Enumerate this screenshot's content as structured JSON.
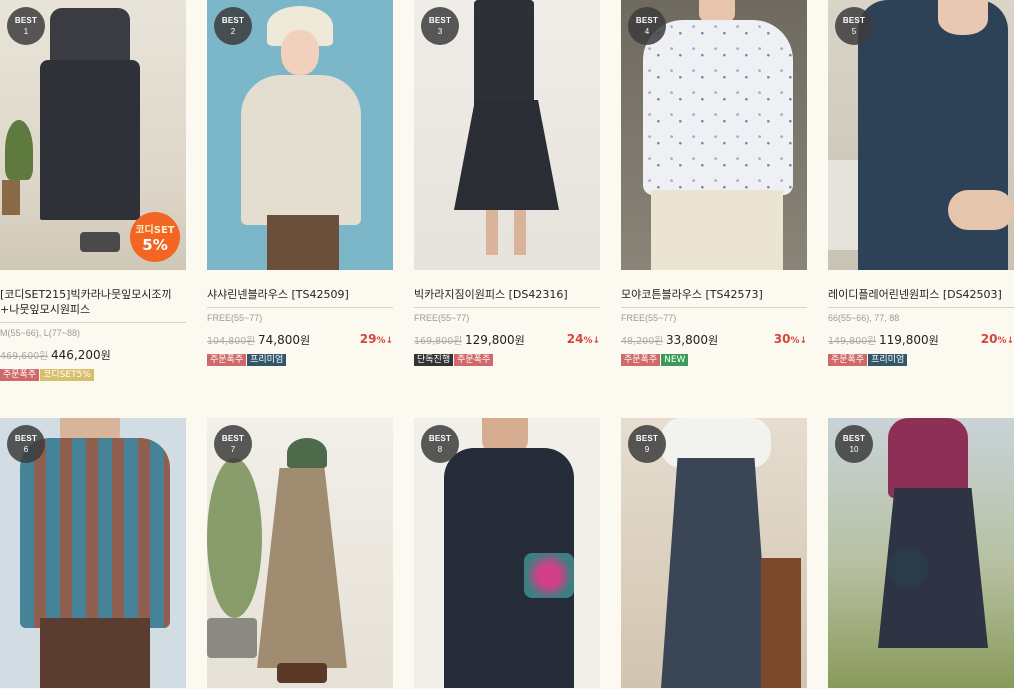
{
  "products_row1": [
    {
      "best_label": "BEST",
      "rank": "1",
      "title": "[코디SET215]빅카라나뭇잎모시조끼+나뭇잎모시원피스",
      "size": "M(55~66), L(77~88)",
      "old_price": "469,600원",
      "price": "446,200",
      "won": "원",
      "rate": "",
      "tags": [
        "주문폭주",
        "코디SET5%"
      ],
      "coupon": {
        "line1": "코디SET",
        "line2": "5%"
      }
    },
    {
      "best_label": "BEST",
      "rank": "2",
      "title": "샤샤린넨블라우스 [TS42509]",
      "size": "FREE(55~77)",
      "old_price": "104,800원",
      "price": "74,800",
      "won": "원",
      "rate": "29",
      "tags": [
        "주문폭주",
        "프리미엄"
      ]
    },
    {
      "best_label": "BEST",
      "rank": "3",
      "title": "빅카라지짐이원피스 [DS42316]",
      "size": "FREE(55~77)",
      "old_price": "169,800원",
      "price": "129,800",
      "won": "원",
      "rate": "24",
      "tags": [
        "단독진행",
        "주문폭주"
      ]
    },
    {
      "best_label": "BEST",
      "rank": "4",
      "title": "모야코튼블라우스 [TS42573]",
      "size": "FREE(55~77)",
      "old_price": "48,200원",
      "price": "33,800",
      "won": "원",
      "rate": "30",
      "tags": [
        "주문폭주",
        "NEW"
      ]
    },
    {
      "best_label": "BEST",
      "rank": "5",
      "title": "레이디플레어린넨원피스 [DS42503]",
      "size": "66(55~66), 77, 88",
      "old_price": "149,800원",
      "price": "119,800",
      "won": "원",
      "rate": "20",
      "tags": [
        "주문폭주",
        "프리미엄"
      ]
    }
  ],
  "products_row2": [
    {
      "best_label": "BEST",
      "rank": "6"
    },
    {
      "best_label": "BEST",
      "rank": "7"
    },
    {
      "best_label": "BEST",
      "rank": "8"
    },
    {
      "best_label": "BEST",
      "rank": "9"
    },
    {
      "best_label": "BEST",
      "rank": "10"
    }
  ],
  "rate_suffix": "%↓",
  "colors": {
    "background": "#fcfaf0",
    "discount": "#d6453c",
    "tag_hot": "#d06a6a",
    "tag_premium": "#33566a",
    "tag_exclusive": "#333333",
    "tag_set": "#d8c06a",
    "tag_new": "#3a9a5a"
  }
}
